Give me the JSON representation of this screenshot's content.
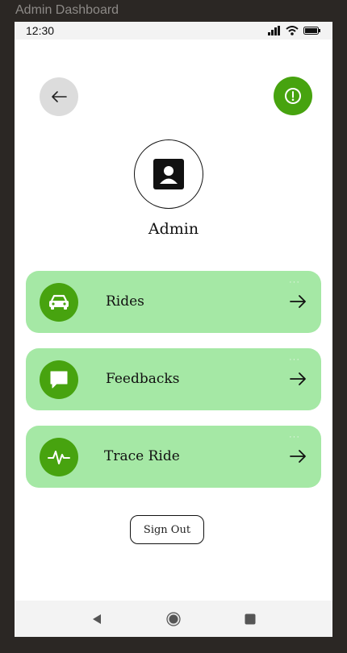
{
  "window": {
    "title": "Admin Dashboard"
  },
  "statusbar": {
    "time": "12:30"
  },
  "header": {
    "back_icon": "arrow-left-icon",
    "alert_icon": "exclamation-circle-icon"
  },
  "profile": {
    "avatar_icon": "user-badge-icon",
    "name": "Admin"
  },
  "menu": {
    "items": [
      {
        "label": "Rides",
        "icon": "car-icon",
        "dots": "···"
      },
      {
        "label": "Feedbacks",
        "icon": "message-icon",
        "dots": "···"
      },
      {
        "label": "Trace Ride",
        "icon": "pulse-icon",
        "dots": "···"
      }
    ]
  },
  "actions": {
    "sign_out_label": "Sign Out"
  },
  "colors": {
    "accent": "#47a30f",
    "card": "#a5e8a5",
    "background": "#ffffff"
  },
  "navbar": {
    "icons": [
      "back-triangle-icon",
      "home-circle-icon",
      "recents-square-icon"
    ]
  }
}
